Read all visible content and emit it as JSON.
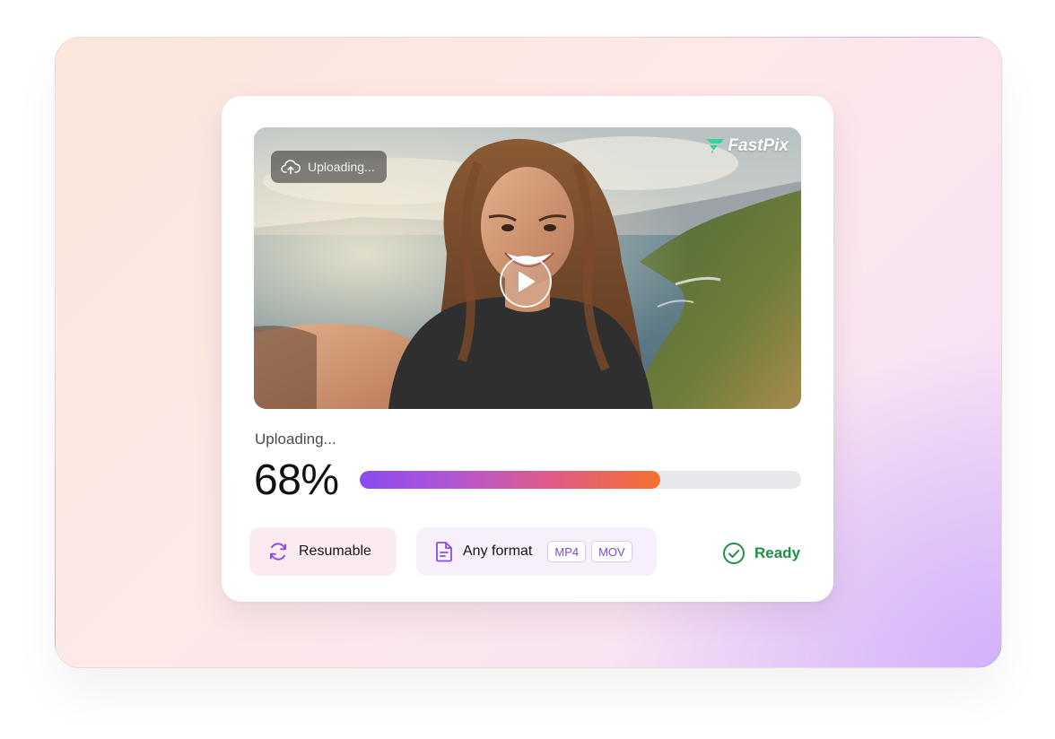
{
  "media": {
    "upload_chip_label": "Uploading...",
    "upload_icon": "cloud-upload-icon",
    "brand_name": "FastPix",
    "brand_icon": "fastpix-logo-icon",
    "play_icon": "play-icon"
  },
  "upload": {
    "status_label": "Uploading...",
    "percent_label": "68%",
    "progress": 0.68
  },
  "features": {
    "resumable_label": "Resumable",
    "resumable_icon": "refresh-icon",
    "format_label": "Any format",
    "format_icon": "document-icon",
    "format_tags": [
      "MP4",
      "MOV"
    ]
  },
  "ready": {
    "label": "Ready",
    "icon": "check-circle-icon"
  },
  "colors": {
    "progress_start": "#8a4bf0",
    "progress_end": "#f6702e",
    "ready_green": "#1f8f46",
    "tag_purple": "#7a48d8"
  }
}
